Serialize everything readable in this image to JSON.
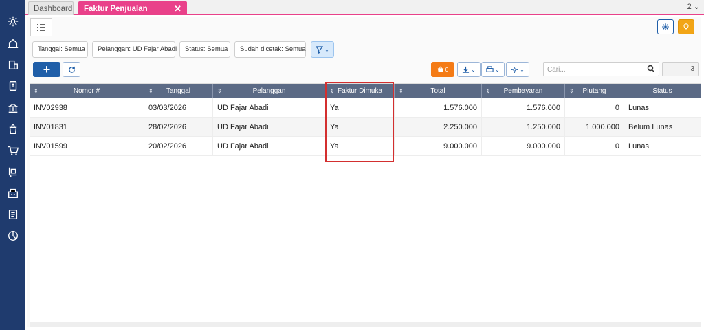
{
  "tabs": {
    "dashboard": "Dashboard",
    "active": "Faktur Penjualan",
    "close_icon": "✕",
    "count": "2 ⌄"
  },
  "filters": [
    {
      "label": "Tanggal: Semua"
    },
    {
      "label": "Pelanggan: UD Fajar Abadi"
    },
    {
      "label": "Status: Semua"
    },
    {
      "label": "Sudah dicetak: Semua"
    }
  ],
  "toolbar": {
    "cart_count": "0",
    "search_placeholder": "Cari...",
    "record_count": "3"
  },
  "columns": [
    "Nomor #",
    "Tanggal",
    "Pelanggan",
    "Faktur Dimuka",
    "Total",
    "Pembayaran",
    "Piutang",
    "Status"
  ],
  "rows": [
    {
      "nomor": "INV02938",
      "tanggal": "03/03/2026",
      "pelanggan": "UD Fajar Abadi",
      "faktur_dimuka": "Ya",
      "total": "1.576.000",
      "pembayaran": "1.576.000",
      "piutang": "0",
      "status": "Lunas"
    },
    {
      "nomor": "INV01831",
      "tanggal": "28/02/2026",
      "pelanggan": "UD Fajar Abadi",
      "faktur_dimuka": "Ya",
      "total": "2.250.000",
      "pembayaran": "1.250.000",
      "piutang": "1.000.000",
      "status": "Belum Lunas"
    },
    {
      "nomor": "INV01599",
      "tanggal": "20/02/2026",
      "pelanggan": "UD Fajar Abadi",
      "faktur_dimuka": "Ya",
      "total": "9.000.000",
      "pembayaran": "9.000.000",
      "piutang": "0",
      "status": "Lunas"
    }
  ],
  "colors": {
    "sidebar": "#1f3b6e",
    "active_tab": "#e9418a",
    "header": "#5b6a85",
    "primary": "#1f5ea8",
    "orange": "#f47b16",
    "highlight": "#d32f2f"
  },
  "icons": [
    "gear-icon",
    "building-icon",
    "office-icon",
    "ledger-icon",
    "bank-icon",
    "bag-icon",
    "cart-icon",
    "trolley-icon",
    "warehouse-icon",
    "report-icon",
    "chart-icon"
  ]
}
